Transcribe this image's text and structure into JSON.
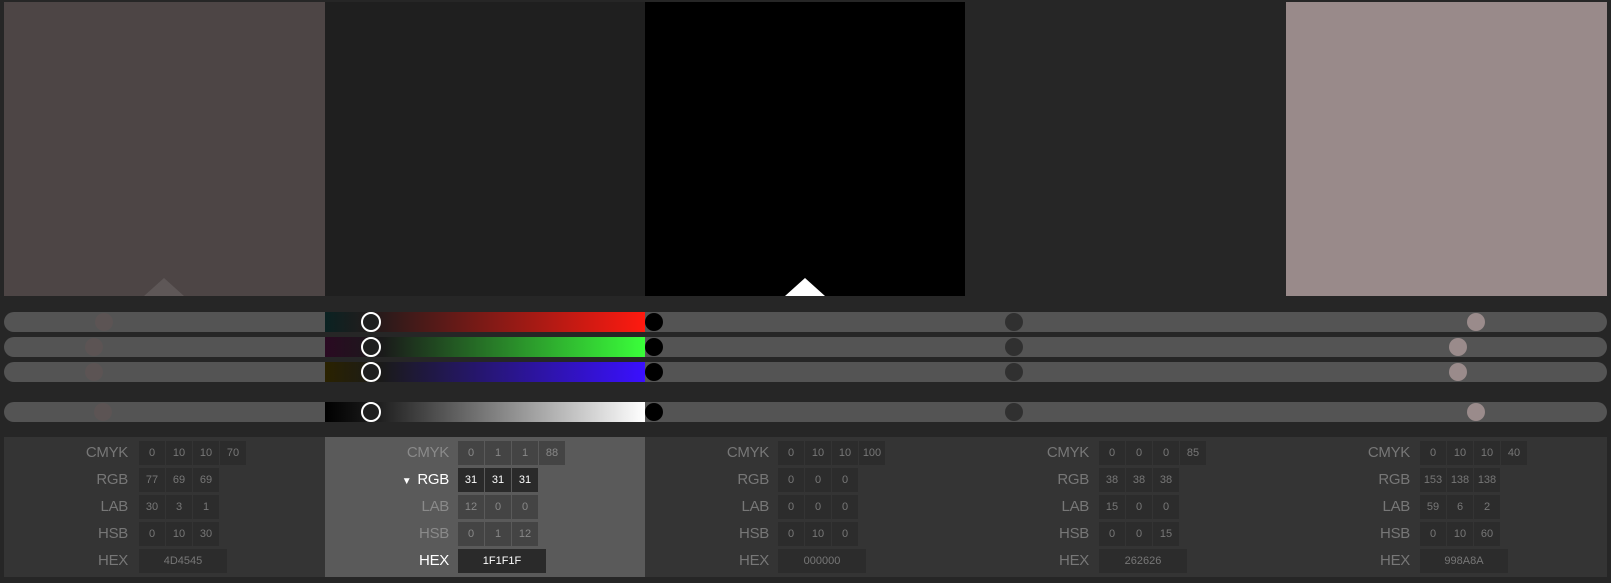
{
  "colors": {
    "c1": "#4D4545",
    "c2": "#1F1F1F",
    "c3": "#000000",
    "c4": "#262626",
    "c5": "#998A8A",
    "background": "#262626",
    "slider_track": "#545454"
  },
  "selected_color_index": 1,
  "sliders": {
    "rows": [
      "red-channel",
      "green-channel",
      "blue-channel",
      "luminance"
    ]
  },
  "panels": [
    {
      "cmyk": {
        "label": "CMYK",
        "values": [
          "0",
          "10",
          "10",
          "70"
        ]
      },
      "rgb": {
        "label": "RGB",
        "values": [
          "77",
          "69",
          "69"
        ]
      },
      "lab": {
        "label": "LAB",
        "values": [
          "30",
          "3",
          "1"
        ]
      },
      "hsb": {
        "label": "HSB",
        "values": [
          "0",
          "10",
          "30"
        ]
      },
      "hex": {
        "label": "HEX",
        "value": "4D4545"
      }
    },
    {
      "cmyk": {
        "label": "CMYK",
        "values": [
          "0",
          "1",
          "1",
          "88"
        ]
      },
      "rgb": {
        "label": "RGB",
        "values": [
          "31",
          "31",
          "31"
        ]
      },
      "lab": {
        "label": "LAB",
        "values": [
          "12",
          "0",
          "0"
        ]
      },
      "hsb": {
        "label": "HSB",
        "values": [
          "0",
          "1",
          "12"
        ]
      },
      "hex": {
        "label": "HEX",
        "value": "1F1F1F"
      }
    },
    {
      "cmyk": {
        "label": "CMYK",
        "values": [
          "0",
          "10",
          "10",
          "100"
        ]
      },
      "rgb": {
        "label": "RGB",
        "values": [
          "0",
          "0",
          "0"
        ]
      },
      "lab": {
        "label": "LAB",
        "values": [
          "0",
          "0",
          "0"
        ]
      },
      "hsb": {
        "label": "HSB",
        "values": [
          "0",
          "10",
          "0"
        ]
      },
      "hex": {
        "label": "HEX",
        "value": "000000"
      }
    },
    {
      "cmyk": {
        "label": "CMYK",
        "values": [
          "0",
          "0",
          "0",
          "85"
        ]
      },
      "rgb": {
        "label": "RGB",
        "values": [
          "38",
          "38",
          "38"
        ]
      },
      "lab": {
        "label": "LAB",
        "values": [
          "15",
          "0",
          "0"
        ]
      },
      "hsb": {
        "label": "HSB",
        "values": [
          "0",
          "0",
          "15"
        ]
      },
      "hex": {
        "label": "HEX",
        "value": "262626"
      }
    },
    {
      "cmyk": {
        "label": "CMYK",
        "values": [
          "0",
          "10",
          "10",
          "40"
        ]
      },
      "rgb": {
        "label": "RGB",
        "values": [
          "153",
          "138",
          "138"
        ]
      },
      "lab": {
        "label": "LAB",
        "values": [
          "59",
          "6",
          "2"
        ]
      },
      "hsb": {
        "label": "HSB",
        "values": [
          "0",
          "10",
          "60"
        ]
      },
      "hex": {
        "label": "HEX",
        "value": "998A8A"
      }
    }
  ]
}
